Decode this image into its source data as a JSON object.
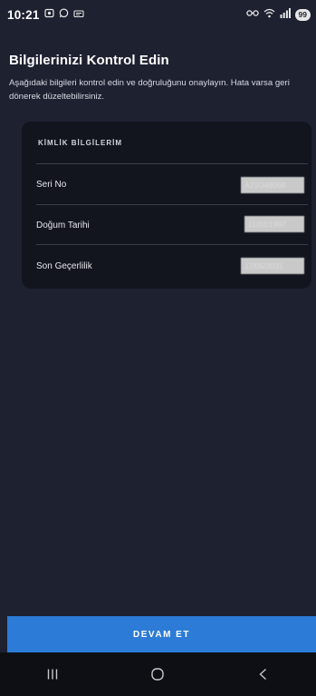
{
  "status_bar": {
    "time": "10:21",
    "battery": "99",
    "left_icons": [
      "screen-record-icon",
      "whatsapp-icon",
      "message-icon"
    ],
    "right_icons": [
      "vowifi-icon",
      "wifi-icon",
      "signal-icon"
    ]
  },
  "page": {
    "title": "Bilgilerinizi Kontrol Edin",
    "subtitle": "Aşağıdaki bilgileri kontrol edin ve doğruluğunu onaylayın. Hata varsa geri dönerek düzeltebilirsiniz."
  },
  "card": {
    "title": "KİMLİK BİLGİLERİM",
    "rows": [
      {
        "label": "Seri No",
        "value": "A21O48056"
      },
      {
        "label": "Doğum Tarihi",
        "value": "11/02/1997"
      },
      {
        "label": "Son Geçerlilik",
        "value": "17/05/2031"
      }
    ]
  },
  "primary_button": {
    "label": "DEVAM ET"
  },
  "colors": {
    "background": "#1e2130",
    "card": "#13151e",
    "accent": "#2c7bd6"
  }
}
